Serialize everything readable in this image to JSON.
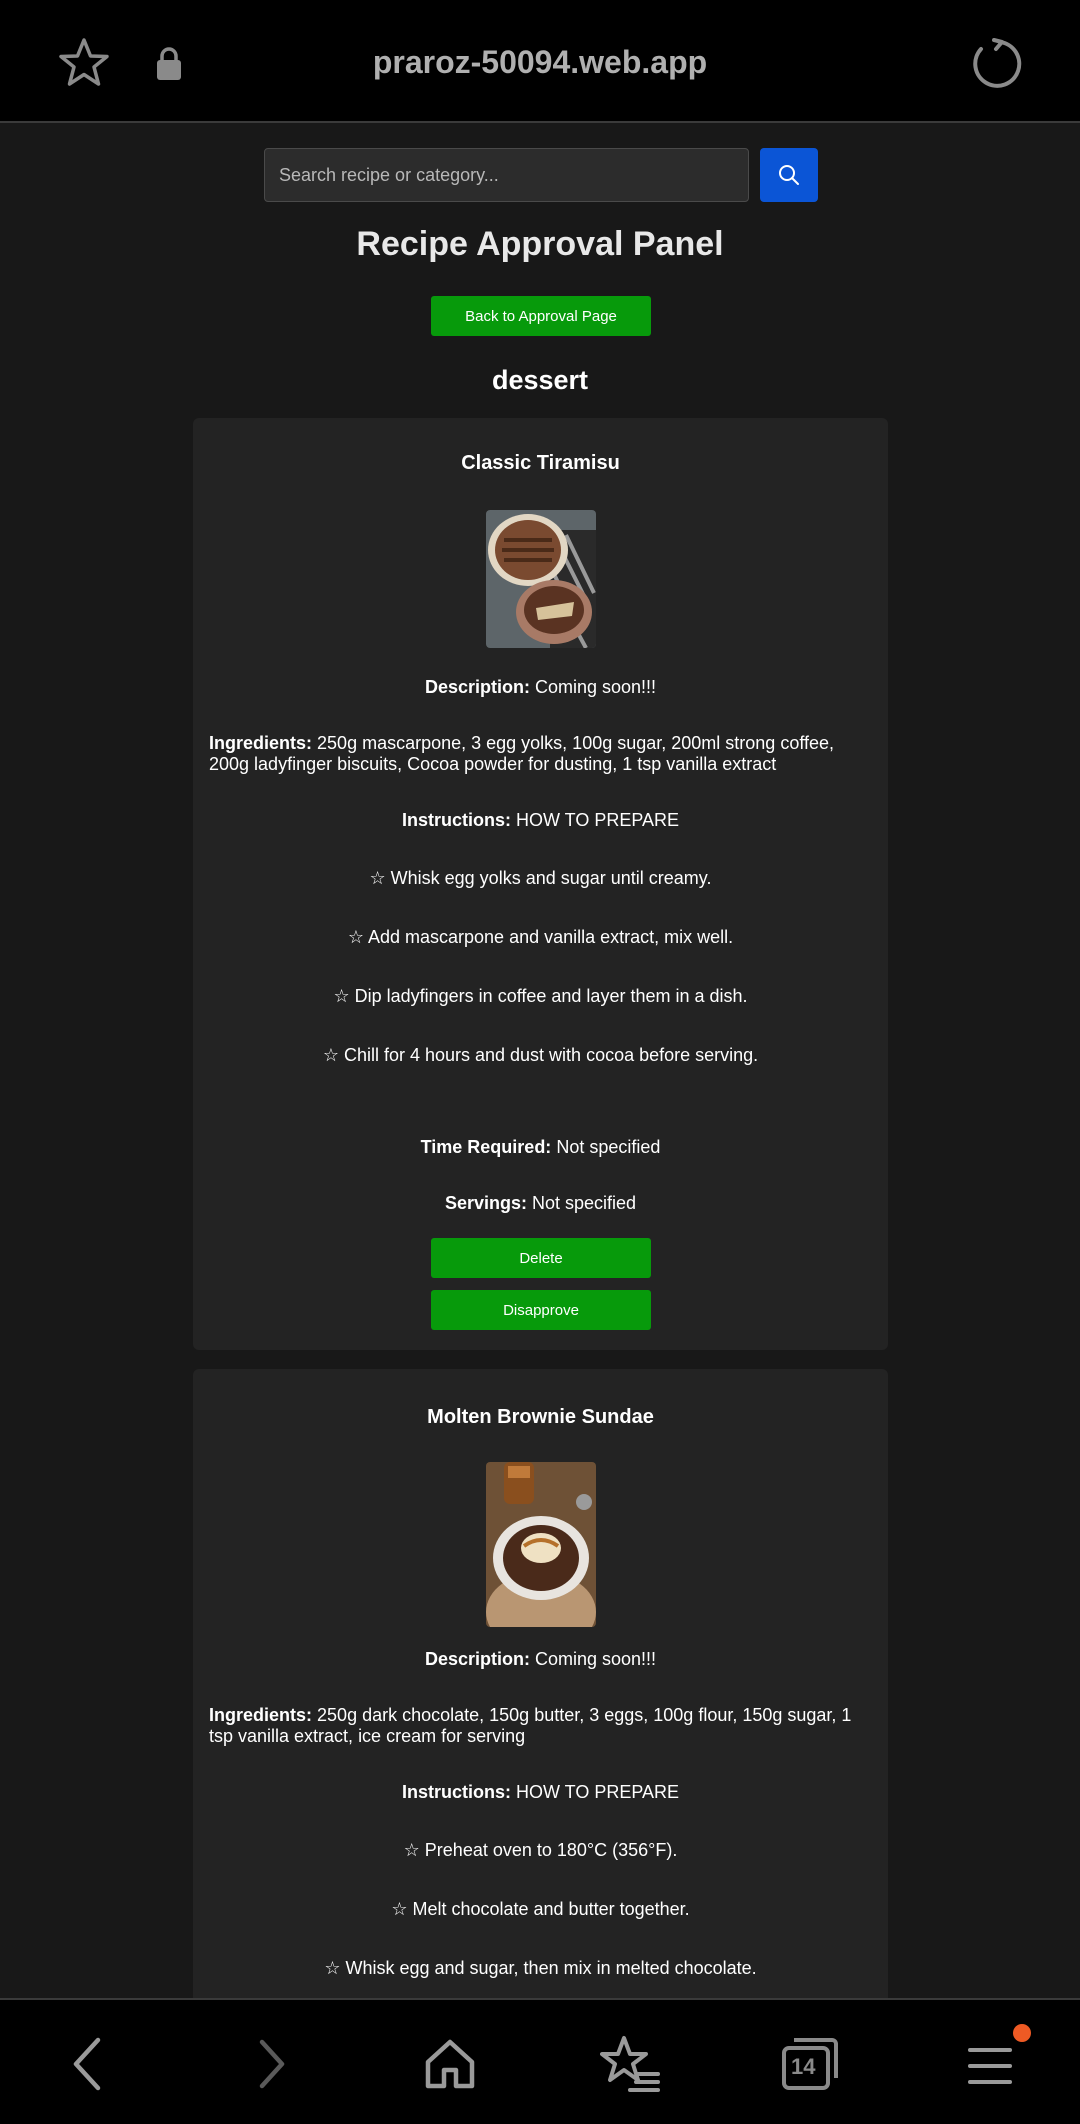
{
  "browser": {
    "url": "praroz-50094.web.app",
    "tab_count": "14"
  },
  "search": {
    "placeholder": "Search recipe or category..."
  },
  "panel": {
    "title": "Recipe Approval Panel",
    "back_label": "Back to Approval Page",
    "category": "dessert"
  },
  "recipes": [
    {
      "name": "Classic Tiramisu",
      "description_label": "Description:",
      "description": "Coming soon!!!",
      "ingredients_label": "Ingredients:",
      "ingredients": "250g mascarpone, 3 egg yolks, 100g sugar, 200ml strong coffee, 200g ladyfinger biscuits, Cocoa powder for dusting, 1 tsp vanilla extract",
      "instructions_label": "Instructions:",
      "instructions": "HOW TO PREPARE",
      "steps": [
        "☆ Whisk egg yolks and sugar until creamy.",
        "☆ Add mascarpone and vanilla extract, mix well.",
        "☆ Dip ladyfingers in coffee and layer them in a dish.",
        "☆ Chill for 4 hours and dust with cocoa before serving."
      ],
      "time_label": "Time Required:",
      "time": "Not specified",
      "servings_label": "Servings:",
      "servings": "Not specified",
      "delete_label": "Delete",
      "disapprove_label": "Disapprove"
    },
    {
      "name": "Molten Brownie Sundae",
      "description_label": "Description:",
      "description": "Coming soon!!!",
      "ingredients_label": "Ingredients:",
      "ingredients": "250g dark chocolate, 150g butter, 3 eggs, 100g flour, 150g sugar, 1 tsp vanilla extract, ice cream for serving",
      "instructions_label": "Instructions:",
      "instructions": "HOW TO PREPARE",
      "steps": [
        "☆ Preheat oven to 180°C (356°F).",
        "☆ Melt chocolate and butter together.",
        "☆ Whisk egg and sugar, then mix in melted chocolate."
      ]
    }
  ]
}
